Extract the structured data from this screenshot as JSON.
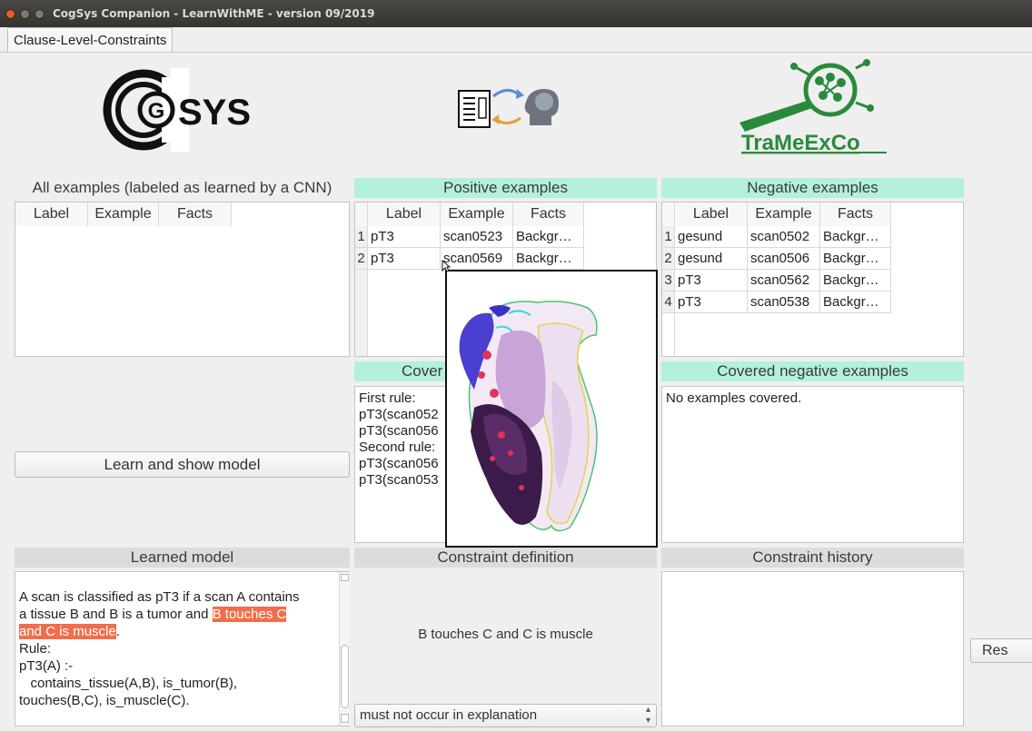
{
  "window": {
    "title": "CogSys Companion - LearnWithME - version 09/2019"
  },
  "tabs": [
    {
      "label": "Clause-Level-Constraints"
    }
  ],
  "logos": {
    "cogsys_text": "SYS",
    "cogsys_letter": "G",
    "trameexco": "TraMeExCo"
  },
  "all_examples": {
    "title": "All examples (labeled as learned by a CNN)",
    "columns": [
      "Label",
      "Example",
      "Facts"
    ],
    "rows": []
  },
  "positive_examples": {
    "title": "Positive examples",
    "columns": [
      "Label",
      "Example",
      "Facts"
    ],
    "rows": [
      {
        "n": "1",
        "label": "pT3",
        "example": "scan0523",
        "facts": "Backgr…"
      },
      {
        "n": "2",
        "label": "pT3",
        "example": "scan0569",
        "facts": "Backgr…"
      }
    ]
  },
  "negative_examples": {
    "title": "Negative examples",
    "columns": [
      "Label",
      "Example",
      "Facts"
    ],
    "rows": [
      {
        "n": "1",
        "label": "gesund",
        "example": "scan0502",
        "facts": "Backgr…"
      },
      {
        "n": "2",
        "label": "gesund",
        "example": "scan0506",
        "facts": "Backgr…"
      },
      {
        "n": "3",
        "label": "pT3",
        "example": "scan0562",
        "facts": "Backgr…"
      },
      {
        "n": "4",
        "label": "pT3",
        "example": "scan0538",
        "facts": "Backgr…"
      }
    ]
  },
  "covered_positive": {
    "title": "Cover",
    "lines": [
      "First rule:",
      "pT3(scan052",
      "pT3(scan056",
      "Second rule:",
      "pT3(scan056",
      "pT3(scan053"
    ]
  },
  "covered_negative": {
    "title": "Covered negative examples",
    "text": "No examples covered."
  },
  "learn_button": {
    "label": "Learn and show model"
  },
  "learned_model": {
    "title": "Learned model",
    "line1": "A scan is classified as pT3 if a scan A contains",
    "line2a": "a tissue B and B is a tumor and ",
    "line2b": "B touches C",
    "line3a": "and C is muscle",
    "line3b": ".",
    "line4": "Rule:",
    "line5": "pT3(A) :-",
    "line6": "   contains_tissue(A,B), is_tumor(B),",
    "line7": "touches(B,C), is_muscle(C)."
  },
  "constraint_definition": {
    "title": "Constraint definition",
    "text": "B touches C and C is muscle",
    "select_value": "must not occur in explanation"
  },
  "constraint_history": {
    "title": "Constraint history"
  },
  "reset_button": {
    "label": "Res"
  },
  "colors": {
    "section_mint": "#b3f0de",
    "highlight": "#f06e4b"
  }
}
